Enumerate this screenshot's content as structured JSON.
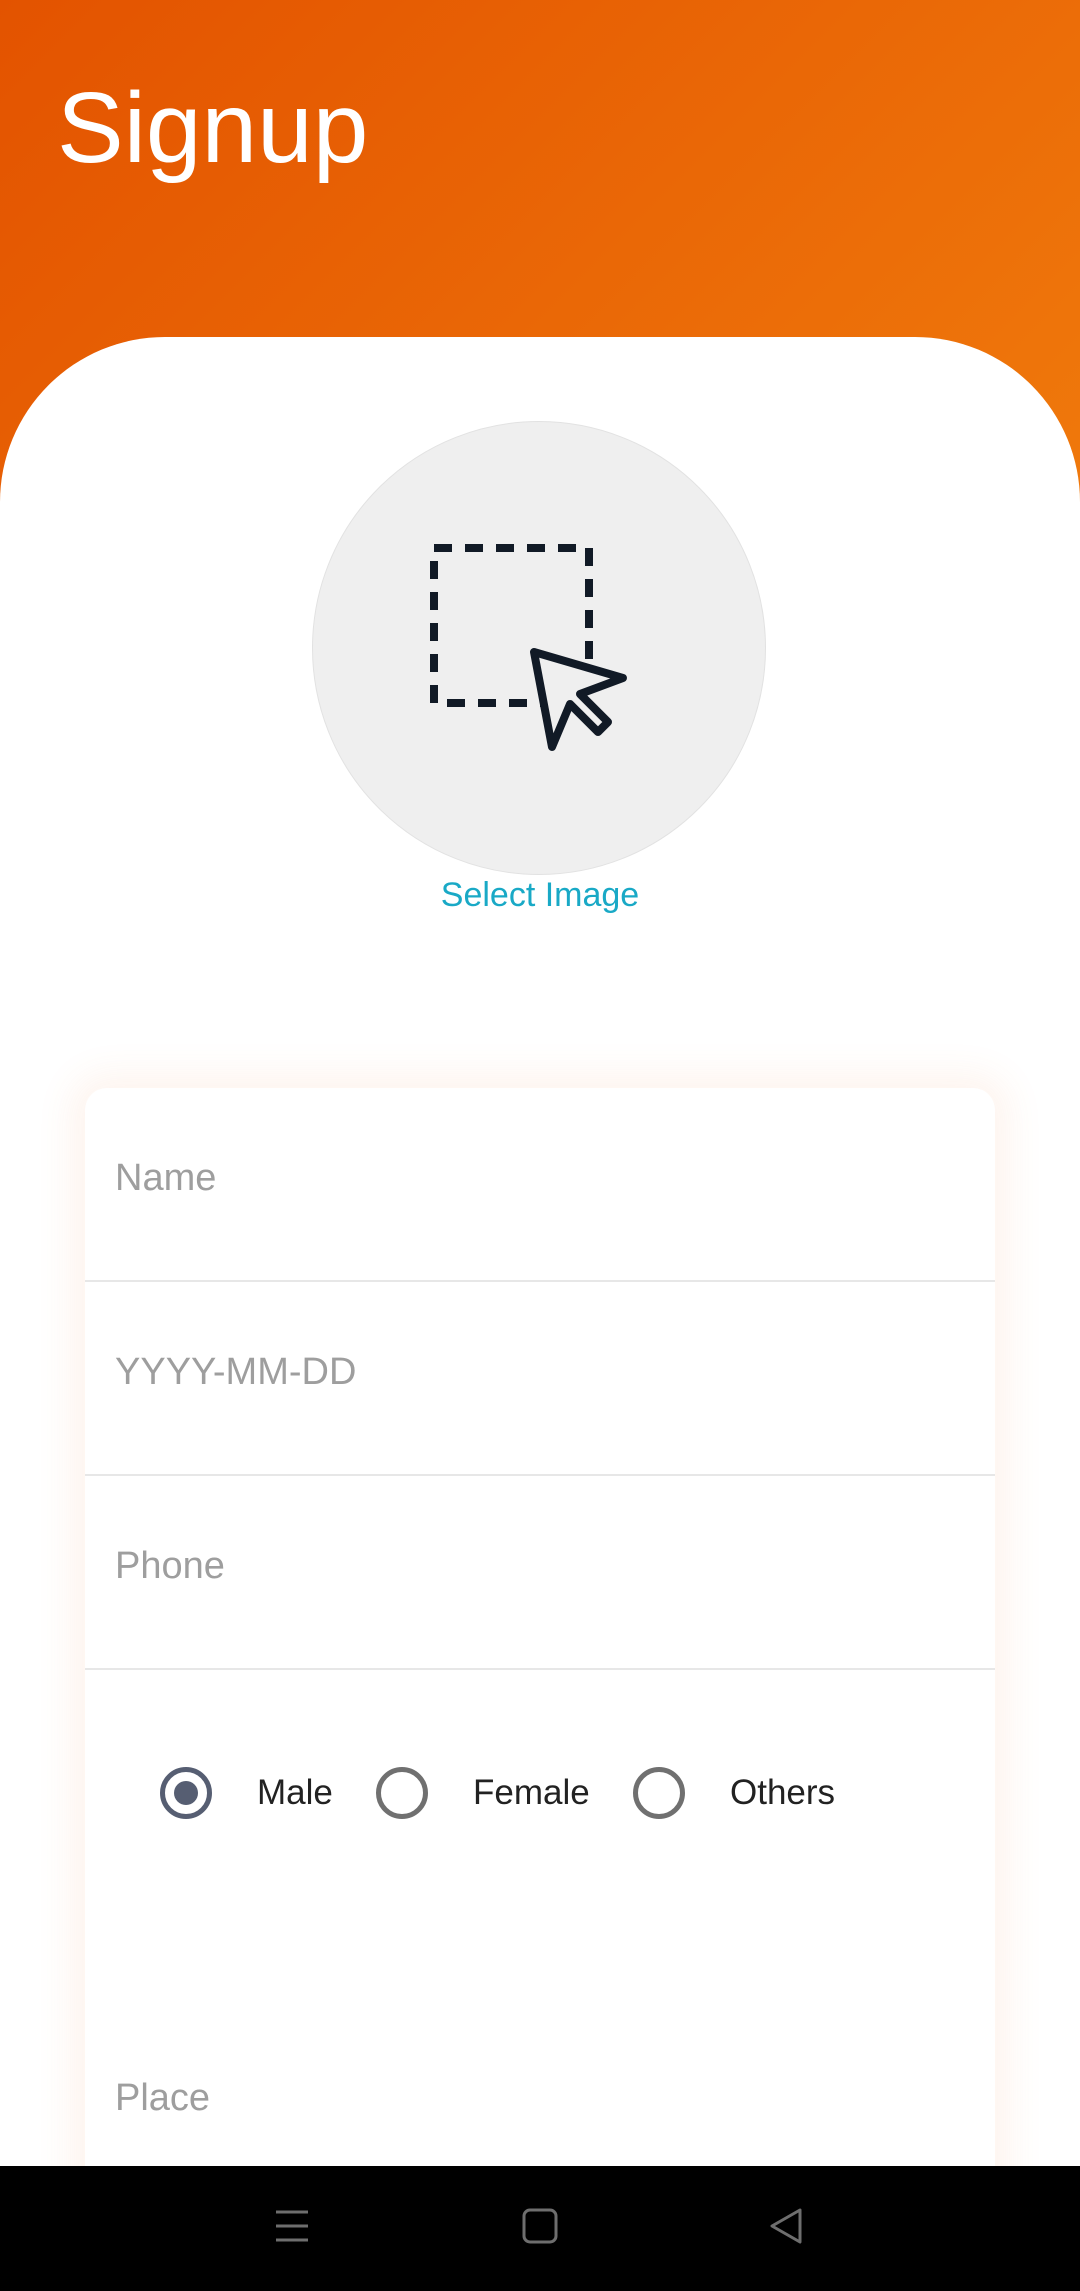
{
  "header": {
    "title": "Signup"
  },
  "avatar": {
    "icon": "select-area-cursor-icon",
    "select_label": "Select Image"
  },
  "form": {
    "name": {
      "placeholder": "Name",
      "value": ""
    },
    "dob": {
      "placeholder": "YYYY-MM-DD",
      "value": ""
    },
    "phone": {
      "placeholder": "Phone",
      "value": ""
    },
    "gender": {
      "options": [
        {
          "label": "Male",
          "selected": true
        },
        {
          "label": "Female",
          "selected": false
        },
        {
          "label": "Others",
          "selected": false
        }
      ]
    },
    "place": {
      "placeholder": "Place",
      "value": ""
    }
  },
  "navbar": {
    "icons": [
      "menu-icon",
      "home-icon",
      "back-icon"
    ]
  },
  "colors": {
    "header_start": "#e35300",
    "header_end": "#f07a0c",
    "accent_link": "#19a9c6",
    "radio_checked": "#565e72"
  }
}
